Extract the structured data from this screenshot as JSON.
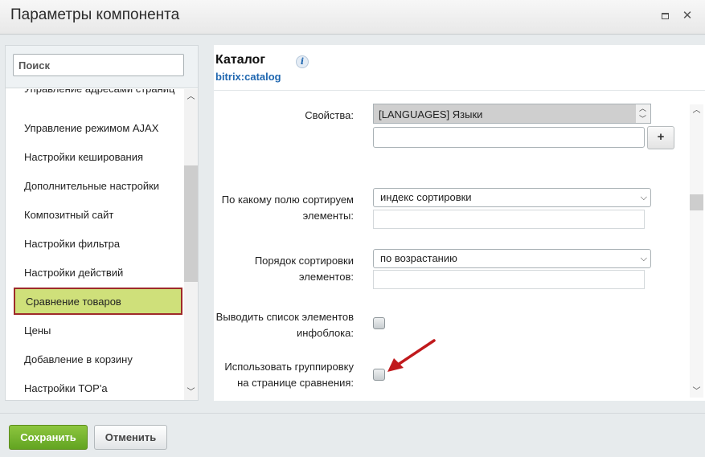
{
  "window": {
    "title": "Параметры компонента",
    "maximize_icon": "maximize-icon",
    "close_icon": "close-icon"
  },
  "sidebar": {
    "search_placeholder": "Поиск",
    "items": [
      {
        "label": "Управление адресами страниц"
      },
      {
        "label": "Управление режимом AJAX"
      },
      {
        "label": "Настройки кеширования"
      },
      {
        "label": "Дополнительные настройки"
      },
      {
        "label": "Композитный сайт"
      },
      {
        "label": "Настройки фильтра"
      },
      {
        "label": "Настройки действий"
      },
      {
        "label": "Сравнение товаров",
        "active": true
      },
      {
        "label": "Цены"
      },
      {
        "label": "Добавление в корзину"
      },
      {
        "label": "Настройки TOP'а"
      }
    ]
  },
  "component": {
    "title": "Каталог",
    "code": "bitrix:catalog",
    "info_icon": "info-icon"
  },
  "form": {
    "properties_label": "Свойства:",
    "properties_selected": "[LANGUAGES] Языки",
    "add_button_label": "+",
    "sort_field_label_1": "По какому полю сортируем",
    "sort_field_label_2": "элементы:",
    "sort_field_value": "индекс сортировки",
    "sort_order_label_1": "Порядок сортировки",
    "sort_order_label_2": "элементов:",
    "sort_order_value": "по возрастанию",
    "show_list_label_1": "Выводить список элементов",
    "show_list_label_2": "инфоблока:",
    "show_list_checked": false,
    "grouping_label_1": "Использовать группировку",
    "grouping_label_2": "на странице сравнения:",
    "grouping_checked": false
  },
  "annotation": {
    "arrow_color": "#c0191c",
    "arrow_icon": "red-arrow-icon"
  },
  "footer": {
    "save_label": "Сохранить",
    "cancel_label": "Отменить"
  },
  "colors": {
    "save_button": "#6cae2a",
    "active_item_bg": "#cfe07a",
    "active_item_border": "#9e2a2a",
    "link": "#2067b0"
  }
}
